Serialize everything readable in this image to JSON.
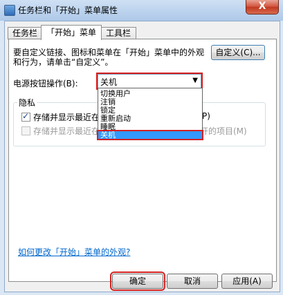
{
  "window": {
    "title": "任务栏和「开始」菜单属性",
    "close_glyph": "X"
  },
  "tabs": [
    {
      "label": "任务栏"
    },
    {
      "label": "「开始」菜单"
    },
    {
      "label": "工具栏"
    }
  ],
  "start_menu": {
    "description": "要自定义链接、图标和菜单在「开始」菜单中的外观和行为，请单击“自定义”。",
    "customize_label": "自定义(C)...",
    "power_label": "电源按钮操作(B):",
    "power_value": "关机",
    "power_options": [
      "切换用户",
      "注销",
      "锁定",
      "重新启动",
      "睡眠",
      "关机"
    ],
    "privacy_label": "隐私",
    "cb1_label": "存储并显示最近在",
    "cb1_tail": "P)",
    "cb1_checked": true,
    "cb2_label": "存储并显示最近在",
    "cb2_tail": "开的项目(M)",
    "cb2_checked": false,
    "help_link": "如何更改「开始」菜单的外观?"
  },
  "buttons": {
    "ok": "确定",
    "cancel": "取消",
    "apply": "应用(A)"
  }
}
